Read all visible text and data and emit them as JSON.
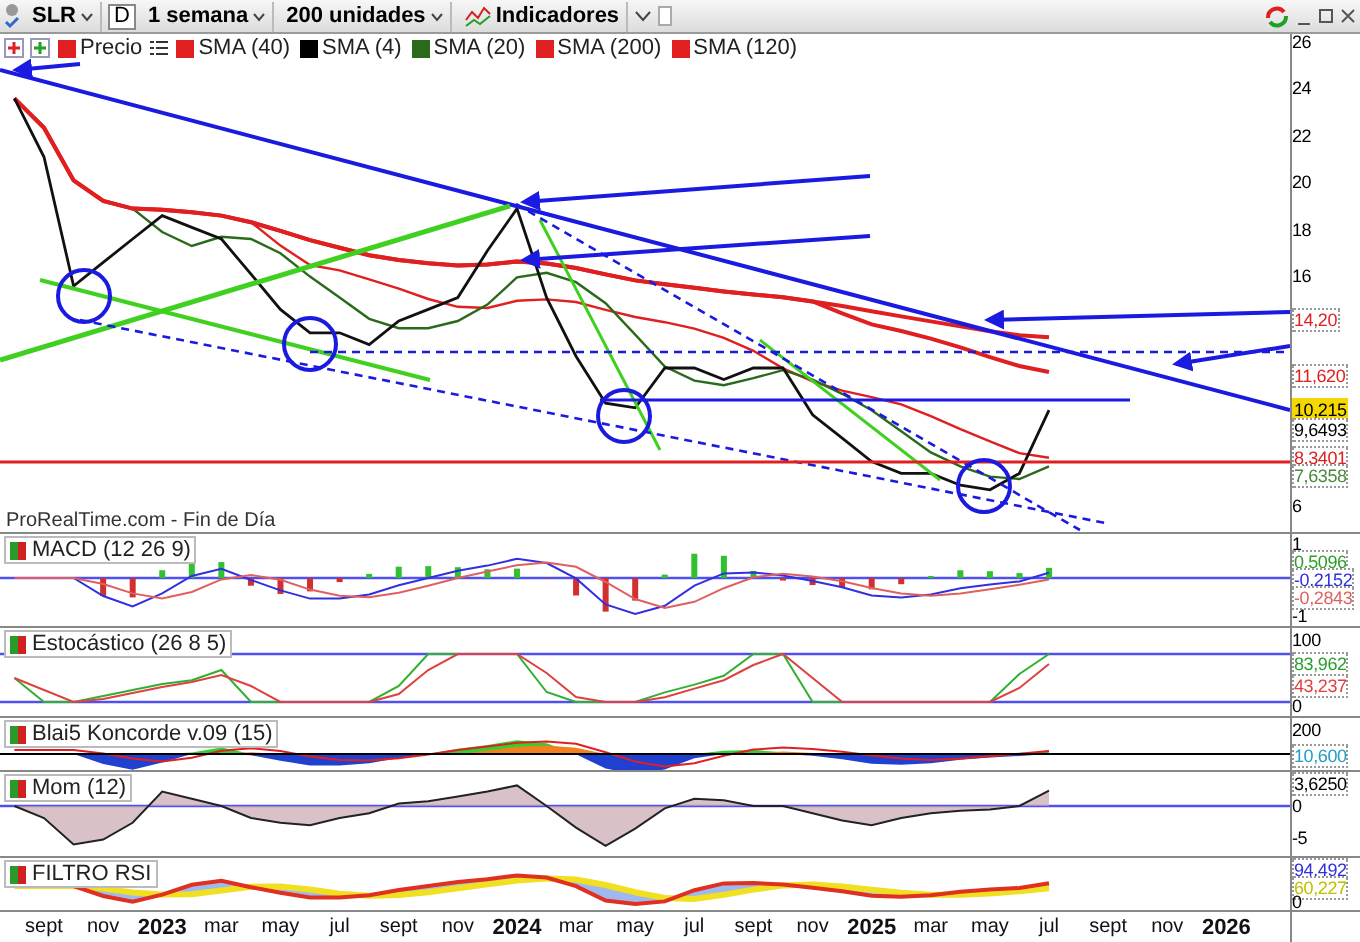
{
  "toolbar": {
    "symbol": "SLR",
    "period_button": "D",
    "timeframe": "1 semana",
    "units": "200 unidades",
    "indicators": "Indicadores"
  },
  "legend": [
    {
      "label": "Precio",
      "color": "#e02020"
    },
    {
      "label": "SMA (40)",
      "color": "#e02020"
    },
    {
      "label": "SMA (4)",
      "color": "#000000"
    },
    {
      "label": "SMA (20)",
      "color": "#2a6a1a"
    },
    {
      "label": "SMA (200)",
      "color": "#e02020"
    },
    {
      "label": "SMA (120)",
      "color": "#e02020"
    }
  ],
  "main_chart": {
    "y_axis": [
      "26",
      "24",
      "22",
      "20",
      "18",
      "16",
      "6"
    ],
    "price_labels": [
      {
        "text": "14,20",
        "color": "#e02020"
      },
      {
        "text": "11,620",
        "color": "#e02020"
      },
      {
        "text": "10,215",
        "color": "#f5d800",
        "kind": "highlight"
      },
      {
        "text": "9,6493",
        "color": "#000000"
      },
      {
        "text": "8,3401",
        "color": "#e02020"
      },
      {
        "text": "7,6358",
        "color": "#4a8a3a"
      }
    ],
    "source": "ProRealTime.com - Fin de Día"
  },
  "panes": [
    {
      "title": "MACD (12 26 9)",
      "kind": "macd",
      "axis": [
        {
          "text": "1",
          "kind": "tick"
        },
        {
          "text": "0,5096",
          "kind": "value",
          "color": "#2aa02a"
        },
        {
          "text": "-0,2152",
          "kind": "value",
          "color": "#3030e0"
        },
        {
          "text": "-0,2843",
          "kind": "value",
          "color": "#e06060"
        },
        {
          "text": "-1",
          "kind": "tick"
        }
      ]
    },
    {
      "title": "Estocástico (26 8 5)",
      "kind": "stochastic",
      "axis": [
        {
          "text": "100",
          "kind": "tick"
        },
        {
          "text": "83,962",
          "kind": "value",
          "color": "#2aa02a"
        },
        {
          "text": "43,237",
          "kind": "value",
          "color": "#e04040"
        },
        {
          "text": "0",
          "kind": "tick"
        }
      ]
    },
    {
      "title": "Blai5 Koncorde v.09 (15)",
      "kind": "koncorde",
      "axis": [
        {
          "text": "200",
          "kind": "tick"
        },
        {
          "text": "10,600",
          "kind": "value",
          "color": "#20a0c0"
        }
      ]
    },
    {
      "title": "Mom (12)",
      "kind": "momentum",
      "axis": [
        {
          "text": "3,6250",
          "kind": "value",
          "color": "#000000"
        },
        {
          "text": "0",
          "kind": "tick"
        },
        {
          "text": "-5",
          "kind": "tick"
        }
      ]
    },
    {
      "title": "FILTRO RSI",
      "kind": "rsi",
      "axis": [
        {
          "text": "94,492",
          "kind": "value",
          "color": "#3030e0"
        },
        {
          "text": "60,227",
          "kind": "value",
          "color": "#c0c000"
        },
        {
          "text": "0",
          "kind": "tick"
        }
      ]
    }
  ],
  "time_axis": [
    {
      "text": "sept",
      "kind": "month"
    },
    {
      "text": "nov",
      "kind": "month"
    },
    {
      "text": "2023",
      "kind": "year"
    },
    {
      "text": "mar",
      "kind": "month"
    },
    {
      "text": "may",
      "kind": "month"
    },
    {
      "text": "jul",
      "kind": "month"
    },
    {
      "text": "sept",
      "kind": "month"
    },
    {
      "text": "nov",
      "kind": "month"
    },
    {
      "text": "2024",
      "kind": "year"
    },
    {
      "text": "mar",
      "kind": "month"
    },
    {
      "text": "may",
      "kind": "month"
    },
    {
      "text": "jul",
      "kind": "month"
    },
    {
      "text": "sept",
      "kind": "month"
    },
    {
      "text": "nov",
      "kind": "month"
    },
    {
      "text": "2025",
      "kind": "year"
    },
    {
      "text": "mar",
      "kind": "month"
    },
    {
      "text": "may",
      "kind": "month"
    },
    {
      "text": "jul",
      "kind": "month"
    },
    {
      "text": "sept",
      "kind": "month"
    },
    {
      "text": "nov",
      "kind": "month"
    },
    {
      "text": "2026",
      "kind": "year"
    }
  ]
}
